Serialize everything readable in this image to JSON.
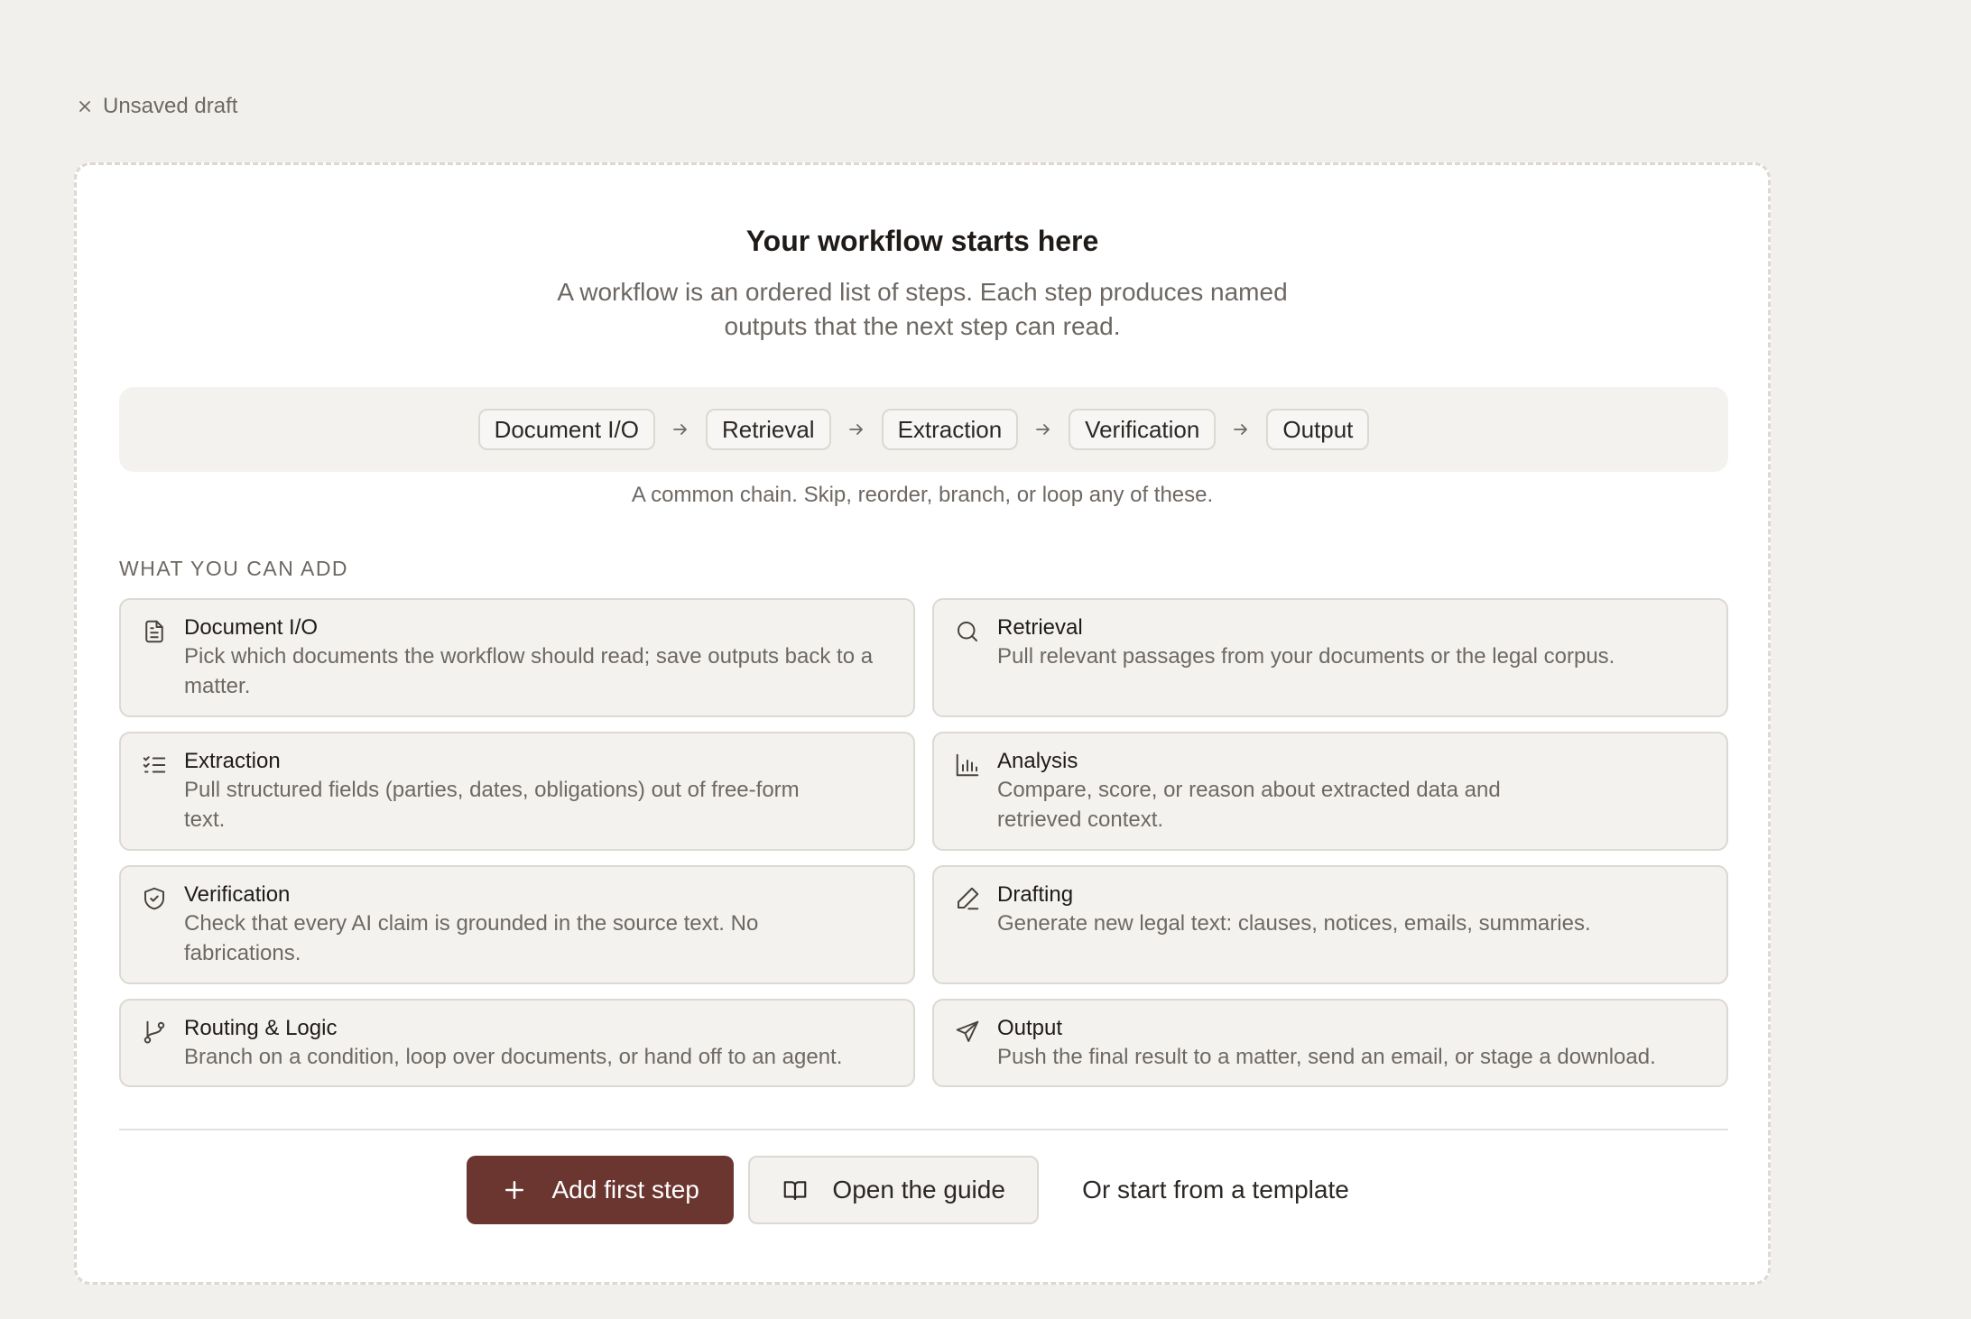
{
  "header": {
    "draft_label": "Unsaved draft"
  },
  "intro": {
    "title": "Your workflow starts here",
    "subtitle_line1": "A workflow is an ordered list of steps. Each step produces named",
    "subtitle_line2": "outputs that the next step can read."
  },
  "chain": {
    "steps": [
      "Document I/O",
      "Retrieval",
      "Extraction",
      "Verification",
      "Output"
    ],
    "caption": "A common chain. Skip, reorder, branch, or loop any of these."
  },
  "add_section": {
    "label": "WHAT YOU CAN ADD",
    "items": [
      {
        "title": "Document I/O",
        "desc": "Pick which documents the workflow should read; save outputs back to a matter.",
        "icon": "document-icon"
      },
      {
        "title": "Retrieval",
        "desc": "Pull relevant passages from your documents or the legal corpus.",
        "icon": "search-icon"
      },
      {
        "title": "Extraction",
        "desc": "Pull structured fields (parties, dates, obligations) out of free-form text.",
        "icon": "checklist-icon"
      },
      {
        "title": "Analysis",
        "desc": "Compare, score, or reason about extracted data and retrieved context.",
        "icon": "bar-chart-icon"
      },
      {
        "title": "Verification",
        "desc": "Check that every AI claim is grounded in the source text. No fabrications.",
        "icon": "shield-check-icon"
      },
      {
        "title": "Drafting",
        "desc": "Generate new legal text: clauses, notices, emails, summaries.",
        "icon": "pen-icon"
      },
      {
        "title": "Routing & Logic",
        "desc": "Branch on a condition, loop over documents, or hand off to an agent.",
        "icon": "git-branch-icon"
      },
      {
        "title": "Output",
        "desc": "Push the final result to a matter, send an email, or stage a download.",
        "icon": "send-icon"
      }
    ]
  },
  "actions": {
    "add_first_step": "Add first step",
    "open_guide": "Open the guide",
    "template_link": "Or start from a template"
  },
  "colors": {
    "primary": "#6b3530",
    "background": "#f2f0ec",
    "card": "#ffffff"
  }
}
